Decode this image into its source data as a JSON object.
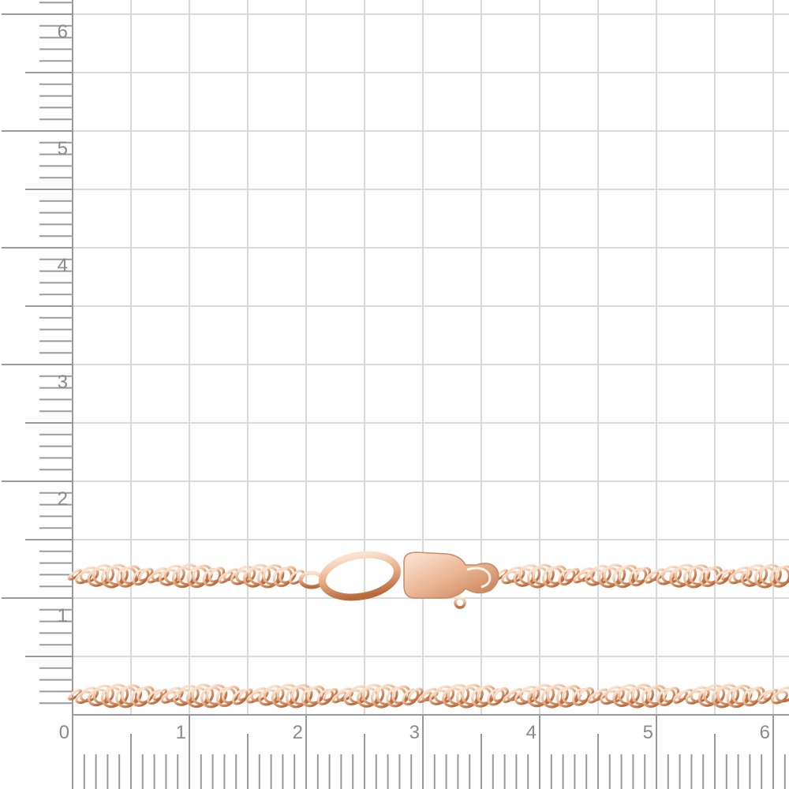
{
  "ruler": {
    "unit_labels": [
      "0",
      "1",
      "2",
      "3",
      "4",
      "5",
      "6"
    ],
    "left_labels": [
      "1",
      "2",
      "3",
      "4",
      "5",
      "6"
    ],
    "grid_color": "#d9d9d9",
    "tick_color": "#9a9a9a",
    "label_color": "#8a8a8a"
  },
  "jewelry": {
    "item": "twisted singapore chain with lobster clasp",
    "metal_color": "#e8a57a",
    "metal_highlight": "#fbe2cf",
    "metal_shadow": "#b86a3c"
  }
}
